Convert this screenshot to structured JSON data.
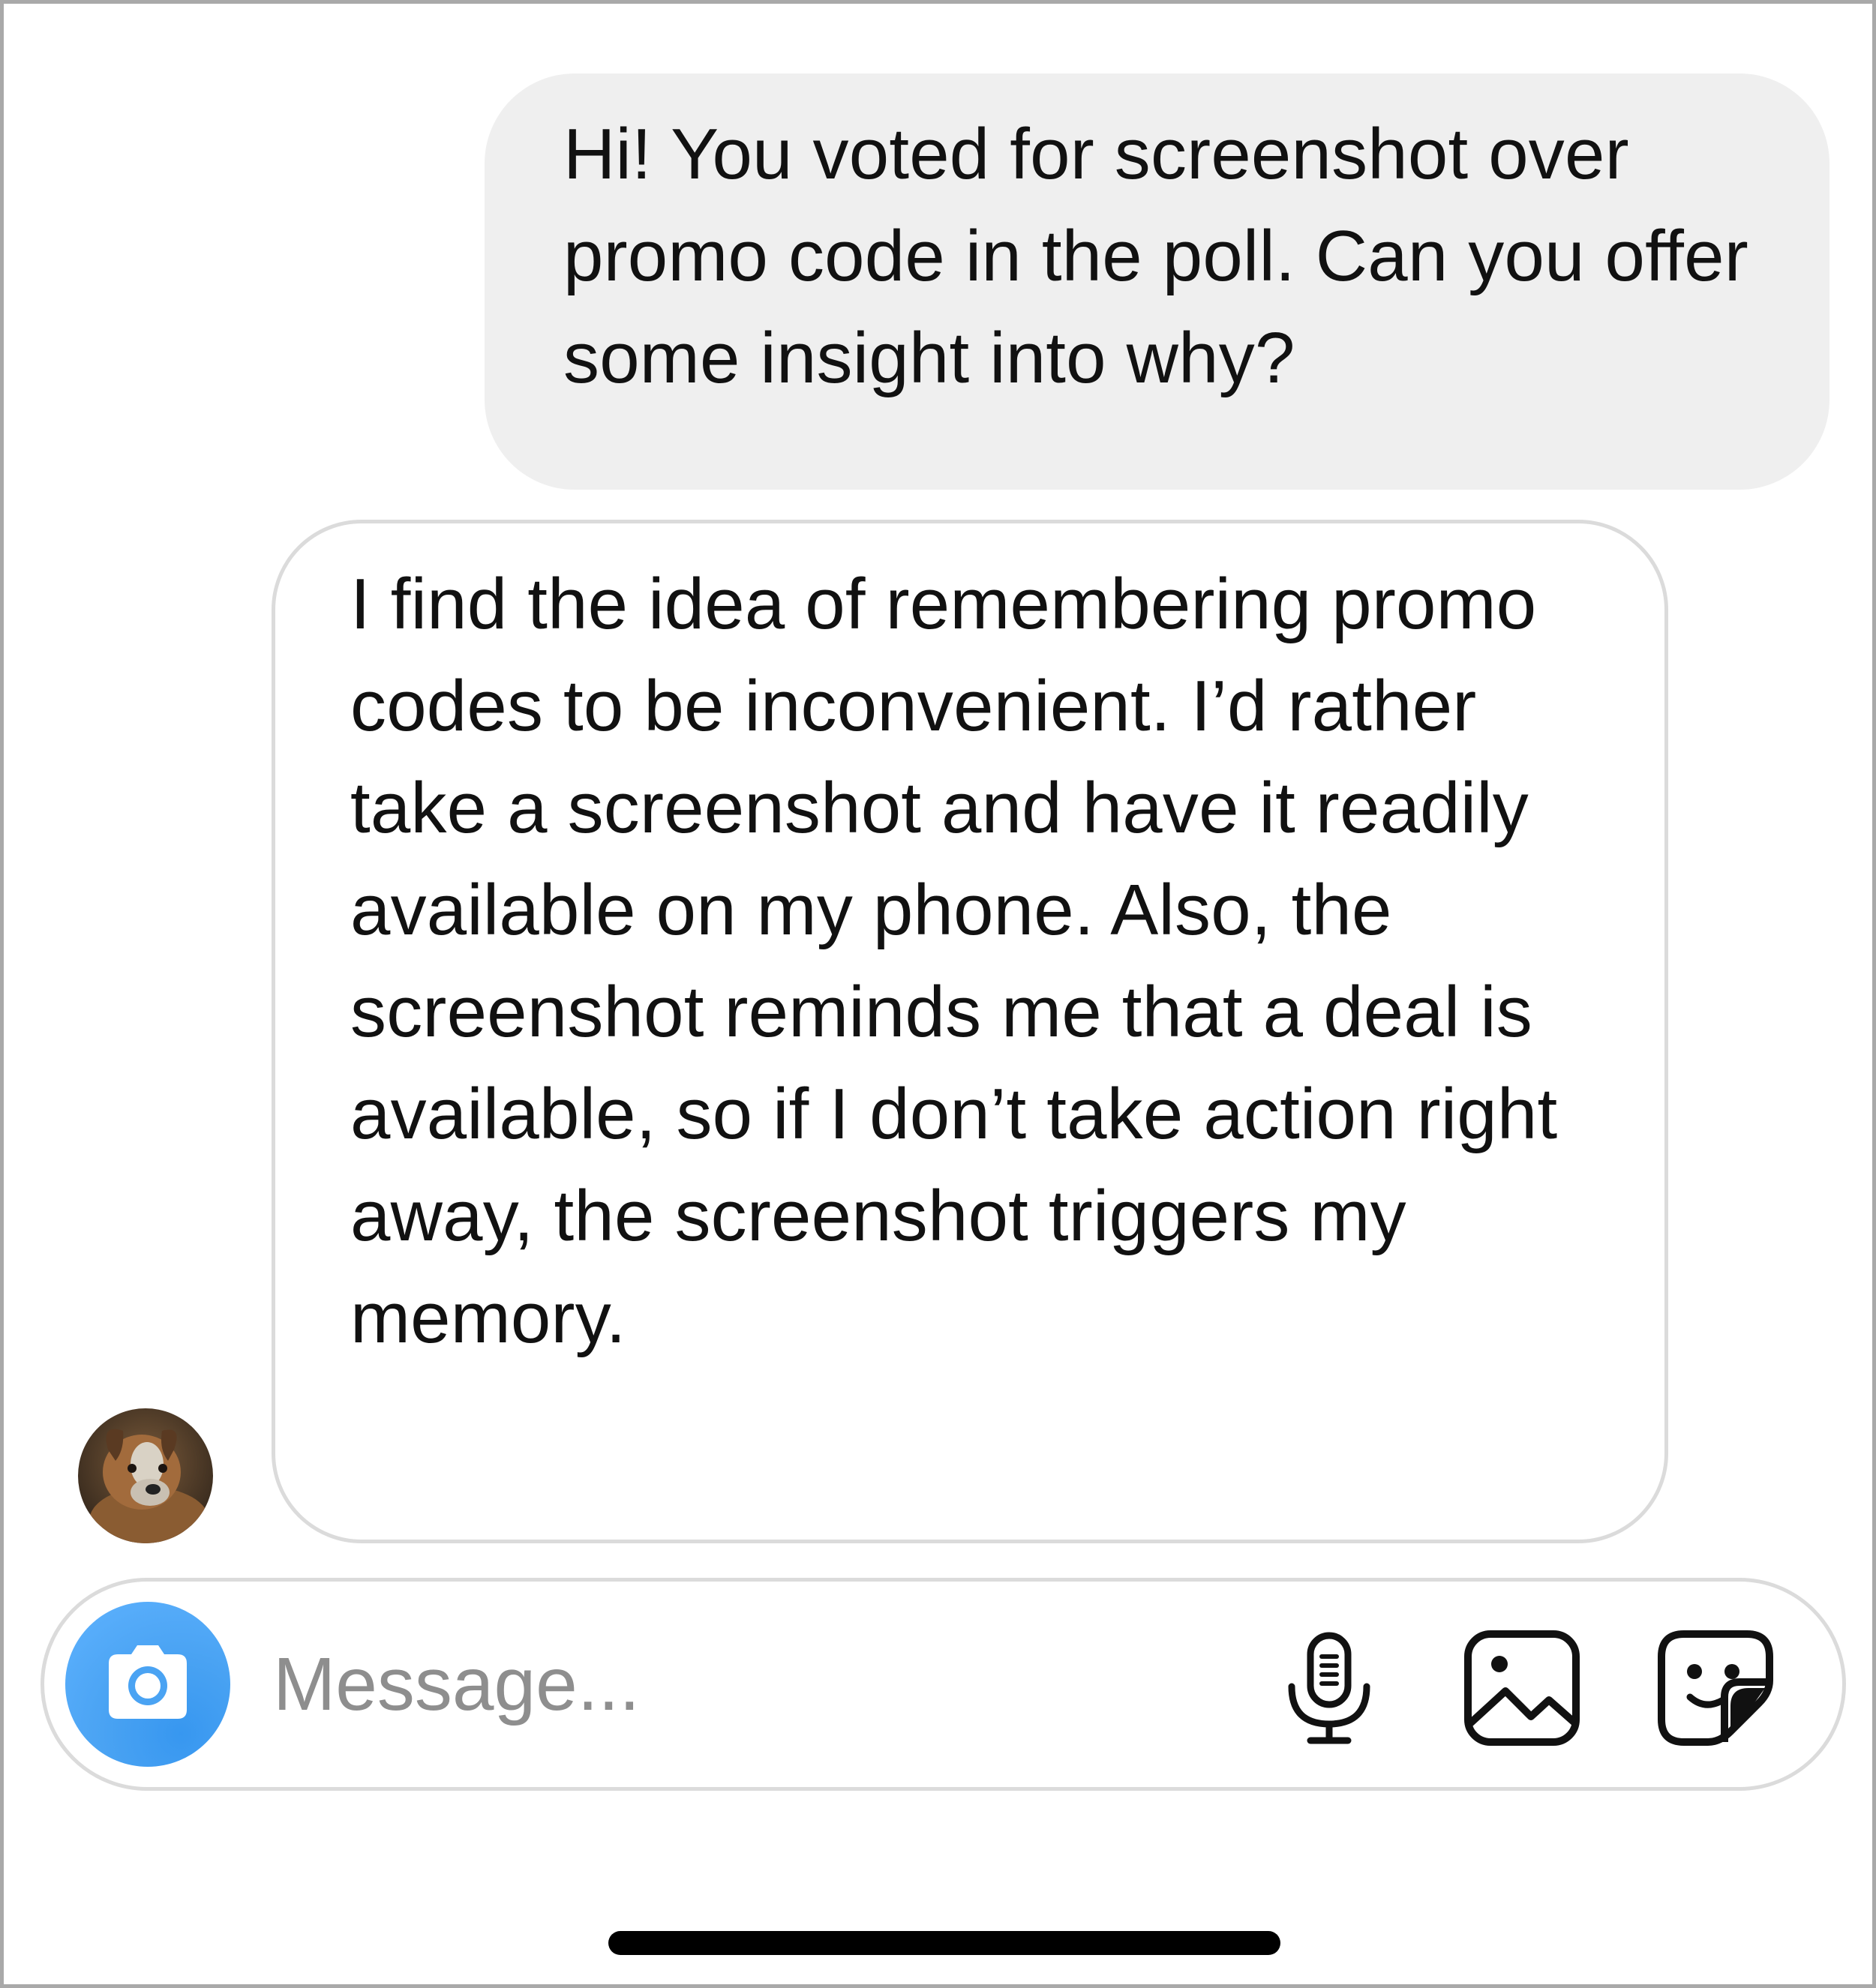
{
  "conversation": {
    "outgoing_message": "Hi! You voted for screenshot over promo code in the poll. Can you offer some insight into why?",
    "incoming_message": "I find the idea of remembering promo codes to be inconvenient. I’d rather take a screenshot and have it readily available on my phone. Also, the screenshot reminds me that a deal is available, so if I don’t take action right away, the screenshot triggers my memory."
  },
  "composer": {
    "placeholder": "Message...",
    "accent_color": "#3797f0",
    "icons": [
      "camera-icon",
      "microphone-icon",
      "gallery-icon",
      "sticker-icon"
    ]
  },
  "colors": {
    "outgoing_bubble": "#efefef",
    "incoming_border": "#dbdbdb",
    "text": "#111111",
    "placeholder": "#8e8e8e"
  }
}
